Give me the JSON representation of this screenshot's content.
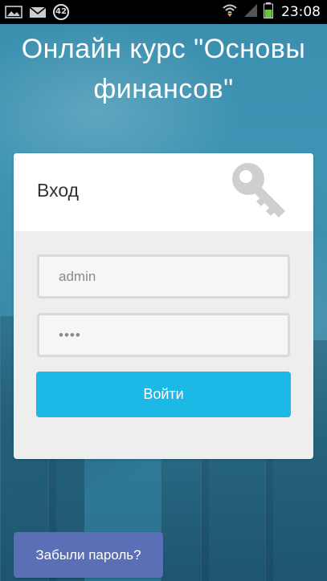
{
  "status_bar": {
    "notification_count": "42",
    "time": "23:08",
    "left_icons": [
      "gallery-icon",
      "mail-icon",
      "notification-badge"
    ],
    "right_icons": [
      "wifi-icon",
      "signal-icon",
      "battery-icon"
    ]
  },
  "page": {
    "title": "Онлайн курс \"Основы финансов\""
  },
  "login_card": {
    "heading": "Вход",
    "username_value": "admin",
    "password_value": "••••",
    "submit_label": "Войти"
  },
  "forgot_password": {
    "label": "Забыли пароль?"
  },
  "colors": {
    "accent": "#1cb8e6",
    "secondary": "#5a6fb5",
    "background": "#3a8fae"
  }
}
